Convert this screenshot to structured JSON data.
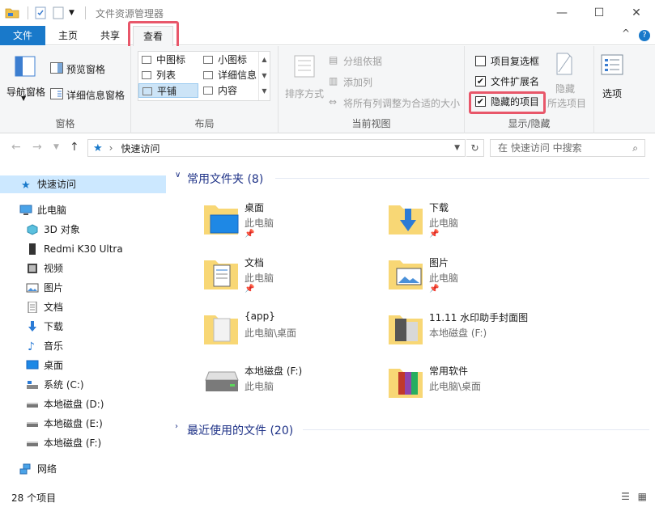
{
  "window": {
    "title": "文件资源管理器",
    "minimize": "—",
    "maximize": "☐",
    "close": "✕"
  },
  "tabs": {
    "file": "文件",
    "home": "主页",
    "share": "共享",
    "view": "查看",
    "collapse": "^",
    "help": "?"
  },
  "ribbon": {
    "panes": {
      "label": "窗格",
      "nav_pane": "导航窗格",
      "preview_pane": "预览窗格",
      "details_pane": "详细信息窗格"
    },
    "layout": {
      "label": "布局",
      "items": [
        "中图标",
        "小图标",
        "列表",
        "详细信息",
        "平铺",
        "内容"
      ],
      "selected": "平铺"
    },
    "current_view": {
      "label": "当前视图",
      "sort_by": "排序方式",
      "group_by": "分组依据",
      "add_column": "添加列",
      "size_all_columns": "将所有列调整为合适的大小"
    },
    "show_hide": {
      "label": "显示/隐藏",
      "item_checkboxes": "项目复选框",
      "item_checkboxes_checked": false,
      "file_extensions": "文件扩展名",
      "file_extensions_checked": true,
      "hidden_items": "隐藏的项目",
      "hidden_items_checked": true,
      "hide_selected_1": "隐藏",
      "hide_selected_2": "所选项目"
    },
    "options": "选项"
  },
  "address": {
    "location": "快速访问",
    "separator": "›",
    "search_placeholder": "在 快速访问 中搜索"
  },
  "nav": {
    "items": [
      {
        "label": "快速访问",
        "icon": "star-icon"
      },
      {
        "label": "此电脑",
        "icon": "computer-icon"
      },
      {
        "label": "3D 对象",
        "icon": "3d-objects-icon"
      },
      {
        "label": "Redmi K30 Ultra",
        "icon": "phone-icon"
      },
      {
        "label": "视频",
        "icon": "video-icon"
      },
      {
        "label": "图片",
        "icon": "pictures-icon"
      },
      {
        "label": "文档",
        "icon": "document-icon"
      },
      {
        "label": "下载",
        "icon": "download-icon"
      },
      {
        "label": "音乐",
        "icon": "music-icon"
      },
      {
        "label": "桌面",
        "icon": "desktop-icon"
      },
      {
        "label": "系统 (C:)",
        "icon": "system-drive-icon"
      },
      {
        "label": "本地磁盘 (D:)",
        "icon": "drive-icon"
      },
      {
        "label": "本地磁盘 (E:)",
        "icon": "drive-icon"
      },
      {
        "label": "本地磁盘 (F:)",
        "icon": "drive-icon"
      },
      {
        "label": "网络",
        "icon": "network-icon"
      }
    ]
  },
  "content": {
    "frequent_header": "常用文件夹 (8)",
    "recent_header": "最近使用的文件 (20)",
    "tiles": [
      {
        "name": "桌面",
        "sub": "此电脑",
        "pinned": true
      },
      {
        "name": "下载",
        "sub": "此电脑",
        "pinned": true
      },
      {
        "name": "文档",
        "sub": "此电脑",
        "pinned": true
      },
      {
        "name": "图片",
        "sub": "此电脑",
        "pinned": true
      },
      {
        "name": "{app}",
        "sub": "此电脑\\桌面",
        "pinned": false
      },
      {
        "name": "11.11 水印助手封面图",
        "sub": "本地磁盘 (F:)",
        "pinned": false
      },
      {
        "name": "本地磁盘 (F:)",
        "sub": "此电脑",
        "pinned": false
      },
      {
        "name": "常用软件",
        "sub": "此电脑\\桌面",
        "pinned": false
      }
    ]
  },
  "status": {
    "count": "28 个项目"
  }
}
